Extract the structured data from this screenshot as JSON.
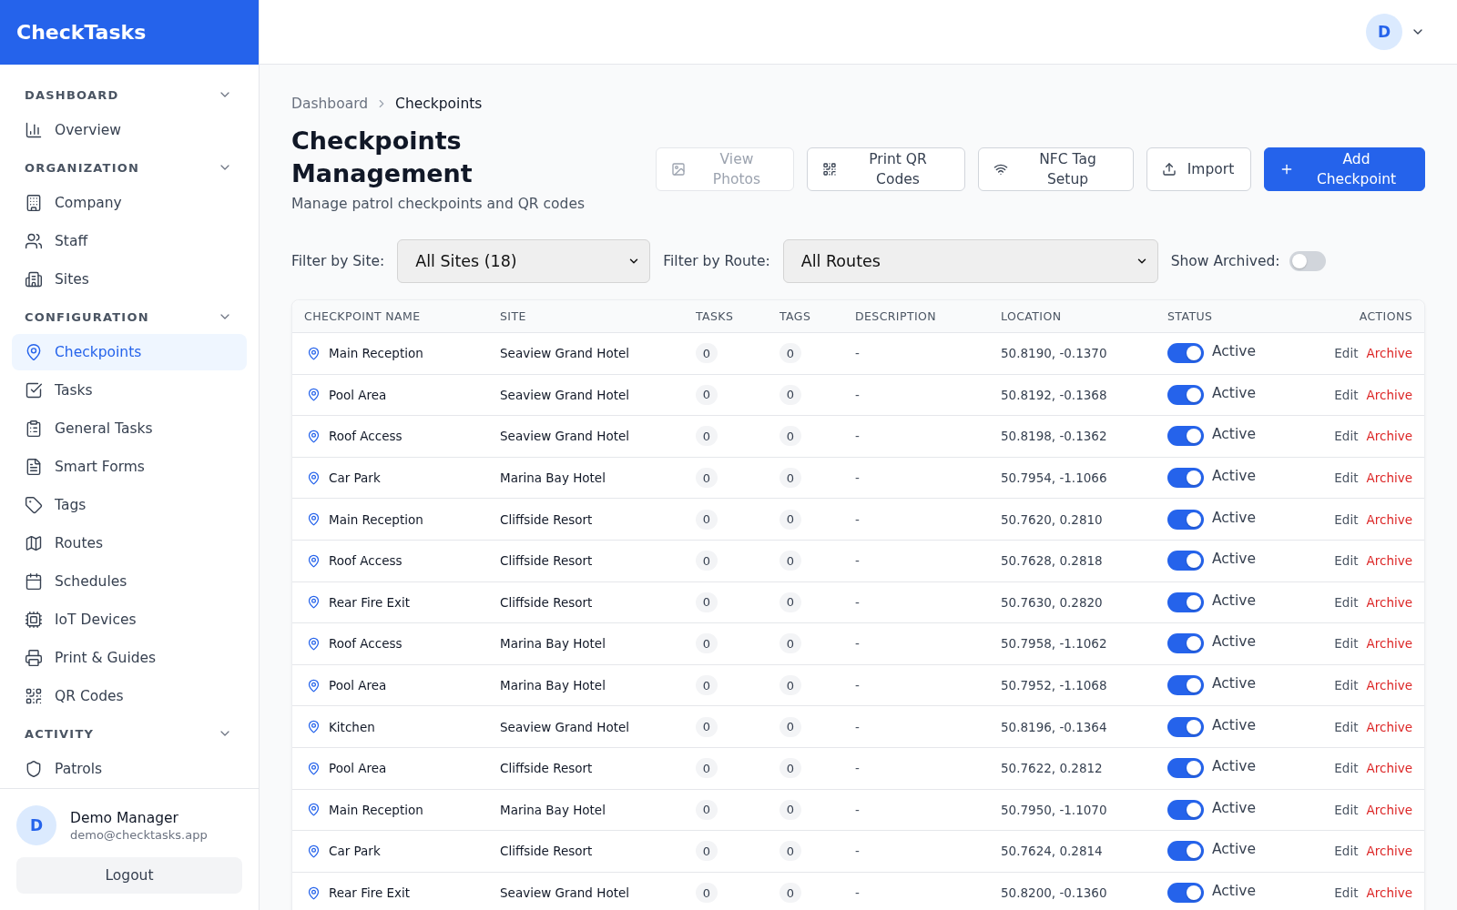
{
  "app": {
    "name": "CheckTasks"
  },
  "sidebar": {
    "sections": [
      {
        "title": "DASHBOARD",
        "expanded": true,
        "items": [
          {
            "label": "Overview",
            "selected": false
          }
        ]
      },
      {
        "title": "ORGANIZATION",
        "expanded": true,
        "items": [
          {
            "label": "Company",
            "selected": false
          },
          {
            "label": "Staff",
            "selected": false
          },
          {
            "label": "Sites",
            "selected": false
          }
        ]
      },
      {
        "title": "CONFIGURATION",
        "expanded": true,
        "items": [
          {
            "label": "Checkpoints",
            "selected": true
          },
          {
            "label": "Tasks",
            "selected": false
          },
          {
            "label": "General Tasks",
            "selected": false
          },
          {
            "label": "Smart Forms",
            "selected": false
          },
          {
            "label": "Tags",
            "selected": false
          },
          {
            "label": "Routes",
            "selected": false
          },
          {
            "label": "Schedules",
            "selected": false
          },
          {
            "label": "IoT Devices",
            "selected": false
          },
          {
            "label": "Print & Guides",
            "selected": false
          },
          {
            "label": "QR Codes",
            "selected": false
          }
        ]
      },
      {
        "title": "ACTIVITY",
        "expanded": true,
        "items": [
          {
            "label": "Patrols",
            "selected": false
          }
        ]
      }
    ]
  },
  "user": {
    "initial": "D",
    "name": "Demo Manager",
    "email": "demo@checktasks.app",
    "logout": "Logout"
  },
  "topbar": {
    "avatar_initial": "D"
  },
  "breadcrumb": [
    {
      "label": "Dashboard",
      "current": false
    },
    {
      "label": "Checkpoints",
      "current": true
    }
  ],
  "page": {
    "title": "Checkpoints Management",
    "subtitle": "Manage patrol checkpoints and QR codes"
  },
  "header_actions": [
    {
      "label": "View Photos",
      "kind": "outline",
      "disabled": true
    },
    {
      "label": "Print QR Codes",
      "kind": "outline",
      "disabled": false
    },
    {
      "label": "NFC Tag Setup",
      "kind": "outline",
      "disabled": false
    },
    {
      "label": "Import",
      "kind": "outline",
      "disabled": false
    },
    {
      "label": "Add Checkpoint",
      "kind": "primary",
      "disabled": false
    }
  ],
  "filters": {
    "site": {
      "label": "Filter by Site:",
      "value": "All Sites (18)"
    },
    "route": {
      "label": "Filter by Route:",
      "value": "All Routes"
    },
    "show_archived": {
      "label": "Show Archived:",
      "on": false
    }
  },
  "table": {
    "columns": [
      "CHECKPOINT NAME",
      "SITE",
      "TASKS",
      "TAGS",
      "DESCRIPTION",
      "LOCATION",
      "STATUS",
      "ACTIONS"
    ],
    "rows": [
      {
        "name": "Main Reception",
        "site": "Seaview Grand Hotel",
        "tasks": "0",
        "tags": "0",
        "description": "-",
        "location": "50.8190, -0.1370",
        "status": {
          "on": true,
          "label": "Active"
        },
        "actions": [
          {
            "label": "Edit",
            "kind": "edit"
          },
          {
            "label": "Archive",
            "kind": "archive"
          }
        ]
      },
      {
        "name": "Pool Area",
        "site": "Seaview Grand Hotel",
        "tasks": "0",
        "tags": "0",
        "description": "-",
        "location": "50.8192, -0.1368",
        "status": {
          "on": true,
          "label": "Active"
        },
        "actions": [
          {
            "label": "Edit",
            "kind": "edit"
          },
          {
            "label": "Archive",
            "kind": "archive"
          }
        ]
      },
      {
        "name": "Roof Access",
        "site": "Seaview Grand Hotel",
        "tasks": "0",
        "tags": "0",
        "description": "-",
        "location": "50.8198, -0.1362",
        "status": {
          "on": true,
          "label": "Active"
        },
        "actions": [
          {
            "label": "Edit",
            "kind": "edit"
          },
          {
            "label": "Archive",
            "kind": "archive"
          }
        ]
      },
      {
        "name": "Car Park",
        "site": "Marina Bay Hotel",
        "tasks": "0",
        "tags": "0",
        "description": "-",
        "location": "50.7954, -1.1066",
        "status": {
          "on": true,
          "label": "Active"
        },
        "actions": [
          {
            "label": "Edit",
            "kind": "edit"
          },
          {
            "label": "Archive",
            "kind": "archive"
          }
        ]
      },
      {
        "name": "Main Reception",
        "site": "Cliffside Resort",
        "tasks": "0",
        "tags": "0",
        "description": "-",
        "location": "50.7620, 0.2810",
        "status": {
          "on": true,
          "label": "Active"
        },
        "actions": [
          {
            "label": "Edit",
            "kind": "edit"
          },
          {
            "label": "Archive",
            "kind": "archive"
          }
        ]
      },
      {
        "name": "Roof Access",
        "site": "Cliffside Resort",
        "tasks": "0",
        "tags": "0",
        "description": "-",
        "location": "50.7628, 0.2818",
        "status": {
          "on": true,
          "label": "Active"
        },
        "actions": [
          {
            "label": "Edit",
            "kind": "edit"
          },
          {
            "label": "Archive",
            "kind": "archive"
          }
        ]
      },
      {
        "name": "Rear Fire Exit",
        "site": "Cliffside Resort",
        "tasks": "0",
        "tags": "0",
        "description": "-",
        "location": "50.7630, 0.2820",
        "status": {
          "on": true,
          "label": "Active"
        },
        "actions": [
          {
            "label": "Edit",
            "kind": "edit"
          },
          {
            "label": "Archive",
            "kind": "archive"
          }
        ]
      },
      {
        "name": "Roof Access",
        "site": "Marina Bay Hotel",
        "tasks": "0",
        "tags": "0",
        "description": "-",
        "location": "50.7958, -1.1062",
        "status": {
          "on": true,
          "label": "Active"
        },
        "actions": [
          {
            "label": "Edit",
            "kind": "edit"
          },
          {
            "label": "Archive",
            "kind": "archive"
          }
        ]
      },
      {
        "name": "Pool Area",
        "site": "Marina Bay Hotel",
        "tasks": "0",
        "tags": "0",
        "description": "-",
        "location": "50.7952, -1.1068",
        "status": {
          "on": true,
          "label": "Active"
        },
        "actions": [
          {
            "label": "Edit",
            "kind": "edit"
          },
          {
            "label": "Archive",
            "kind": "archive"
          }
        ]
      },
      {
        "name": "Kitchen",
        "site": "Seaview Grand Hotel",
        "tasks": "0",
        "tags": "0",
        "description": "-",
        "location": "50.8196, -0.1364",
        "status": {
          "on": true,
          "label": "Active"
        },
        "actions": [
          {
            "label": "Edit",
            "kind": "edit"
          },
          {
            "label": "Archive",
            "kind": "archive"
          }
        ]
      },
      {
        "name": "Pool Area",
        "site": "Cliffside Resort",
        "tasks": "0",
        "tags": "0",
        "description": "-",
        "location": "50.7622, 0.2812",
        "status": {
          "on": true,
          "label": "Active"
        },
        "actions": [
          {
            "label": "Edit",
            "kind": "edit"
          },
          {
            "label": "Archive",
            "kind": "archive"
          }
        ]
      },
      {
        "name": "Main Reception",
        "site": "Marina Bay Hotel",
        "tasks": "0",
        "tags": "0",
        "description": "-",
        "location": "50.7950, -1.1070",
        "status": {
          "on": true,
          "label": "Active"
        },
        "actions": [
          {
            "label": "Edit",
            "kind": "edit"
          },
          {
            "label": "Archive",
            "kind": "archive"
          }
        ]
      },
      {
        "name": "Car Park",
        "site": "Cliffside Resort",
        "tasks": "0",
        "tags": "0",
        "description": "-",
        "location": "50.7624, 0.2814",
        "status": {
          "on": true,
          "label": "Active"
        },
        "actions": [
          {
            "label": "Edit",
            "kind": "edit"
          },
          {
            "label": "Archive",
            "kind": "archive"
          }
        ]
      },
      {
        "name": "Rear Fire Exit",
        "site": "Seaview Grand Hotel",
        "tasks": "0",
        "tags": "0",
        "description": "-",
        "location": "50.8200, -0.1360",
        "status": {
          "on": true,
          "label": "Active"
        },
        "actions": [
          {
            "label": "Edit",
            "kind": "edit"
          },
          {
            "label": "Archive",
            "kind": "archive"
          }
        ]
      }
    ]
  }
}
